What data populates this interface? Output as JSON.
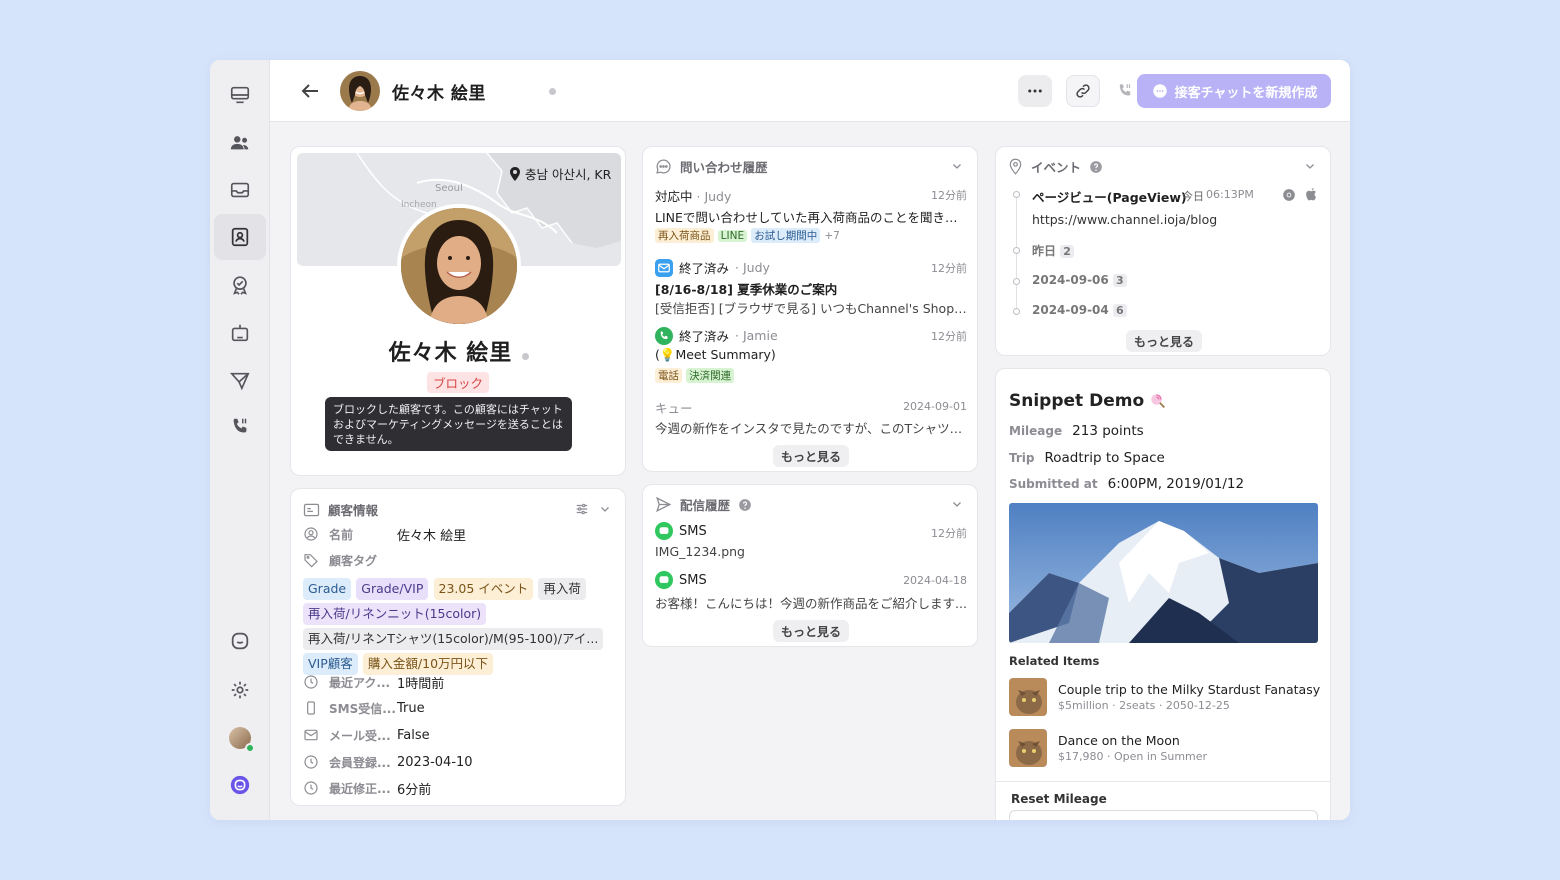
{
  "header": {
    "customer_name": "佐々木 絵里",
    "new_chat_label": "接客チャットを新規作成"
  },
  "profile": {
    "location": "충남 아산시, KR",
    "map_labels": [
      "Seoul",
      "Incheon"
    ],
    "name": "佐々木 絵里",
    "block_badge": "ブロック",
    "tooltip": "ブロックした顧客です。この顧客にはチャットおよびマーケティングメッセージを送ることはできません。"
  },
  "customer_info": {
    "title": "顧客情報",
    "name_label": "名前",
    "name_value": "佐々木 絵里",
    "tags_label": "顧客タグ",
    "tags": [
      {
        "text": "Grade",
        "bg": "#dcecfb",
        "fg": "#2c5b8f"
      },
      {
        "text": "Grade/VIP",
        "bg": "#e8e0fa",
        "fg": "#4b3a8a"
      },
      {
        "text": "23.05 イベント",
        "bg": "#fdeed6",
        "fg": "#7a5418"
      },
      {
        "text": "再入荷",
        "bg": "#ececef",
        "fg": "#333333"
      },
      {
        "text": "再入荷/リネンニット(15color)",
        "bg": "#ece2fa",
        "fg": "#4b3a8a"
      },
      {
        "text": "再入荷/リネンTシャツ(15color)/M(95-100)/アイ...",
        "bg": "#ececef",
        "fg": "#333333"
      },
      {
        "text": "VIP顧客",
        "bg": "#dcecfb",
        "fg": "#2c5b8f"
      },
      {
        "text": "購入金額/10万円以下",
        "bg": "#fdeed6",
        "fg": "#7a5418"
      }
    ],
    "rows": [
      {
        "label": "最近アク...",
        "value": "1時間前"
      },
      {
        "label": "SMS受信...",
        "value": "True"
      },
      {
        "label": "メール受...",
        "value": "False"
      },
      {
        "label": "会員登録...",
        "value": "2023-04-10"
      },
      {
        "label": "最近修正...",
        "value": "6分前"
      }
    ]
  },
  "inquiries": {
    "title": "問い合わせ履歴",
    "items": [
      {
        "status": "対応中",
        "assignee": "· Judy",
        "time": "12分前",
        "text": "LINEで問い合わせしていた再入荷商品のことを聞きた...",
        "tags": [
          "再入荷商品",
          "LINE",
          "お試し期間中"
        ],
        "extra": "+7"
      },
      {
        "status": "終了済み",
        "assignee": "· Judy",
        "time": "12分前",
        "title": "[8/16-8/18] 夏季休業のご案内",
        "text": "[受信拒否] [ブラウザで見る] いつもChannel's Shopを..."
      },
      {
        "status": "終了済み",
        "assignee": "· Jamie",
        "time": "12分前",
        "text": "(💡Meet Summary)",
        "tags": [
          "電話",
          "決済関連"
        ]
      },
      {
        "status": "キュー",
        "time": "2024-09-01",
        "text": "今週の新作をインスタで見たのですが、このTシャツは..."
      }
    ],
    "more": "もっと見る"
  },
  "deliveries": {
    "title": "配信履歴",
    "items": [
      {
        "channel": "SMS",
        "time": "12分前",
        "text": "IMG_1234.png"
      },
      {
        "channel": "SMS",
        "time": "2024-04-18",
        "text": "お客様！こんにちは！今週の新作商品をご紹介します..."
      }
    ],
    "more": "もっと見る"
  },
  "events": {
    "title": "イベント",
    "first": {
      "name": "ページビュー(PageView)",
      "day": "今日",
      "time": "06:13PM",
      "url": "https://www.channel.ioja/blog"
    },
    "groups": [
      {
        "label": "昨日",
        "count": "2"
      },
      {
        "label": "2024-09-06",
        "count": "3"
      },
      {
        "label": "2024-09-04",
        "count": "6"
      }
    ],
    "more": "もっと見る"
  },
  "snippet": {
    "title": "Snippet Demo",
    "fields": [
      {
        "label": "Mileage",
        "value": "213 points"
      },
      {
        "label": "Trip",
        "value": "Roadtrip to Space"
      },
      {
        "label": "Submitted at",
        "value": "6:00PM, 2019/01/12"
      }
    ],
    "related_title": "Related Items",
    "related": [
      {
        "name": "Couple trip to the Milky Stardust Fanatasy",
        "meta": "$5million · 2seats · 2050-12-25"
      },
      {
        "name": "Dance on the Moon",
        "meta": "$17,980 · Open in Summer"
      }
    ],
    "reset_title": "Reset Mileage"
  },
  "colors": {
    "accent": "#b9b2f6",
    "brand": "#6b55e8",
    "block_bg": "#fde3e3",
    "block_fg": "#d64545",
    "tag_line": "#d8f3d2",
    "tag_green": "#d8f3d2"
  }
}
